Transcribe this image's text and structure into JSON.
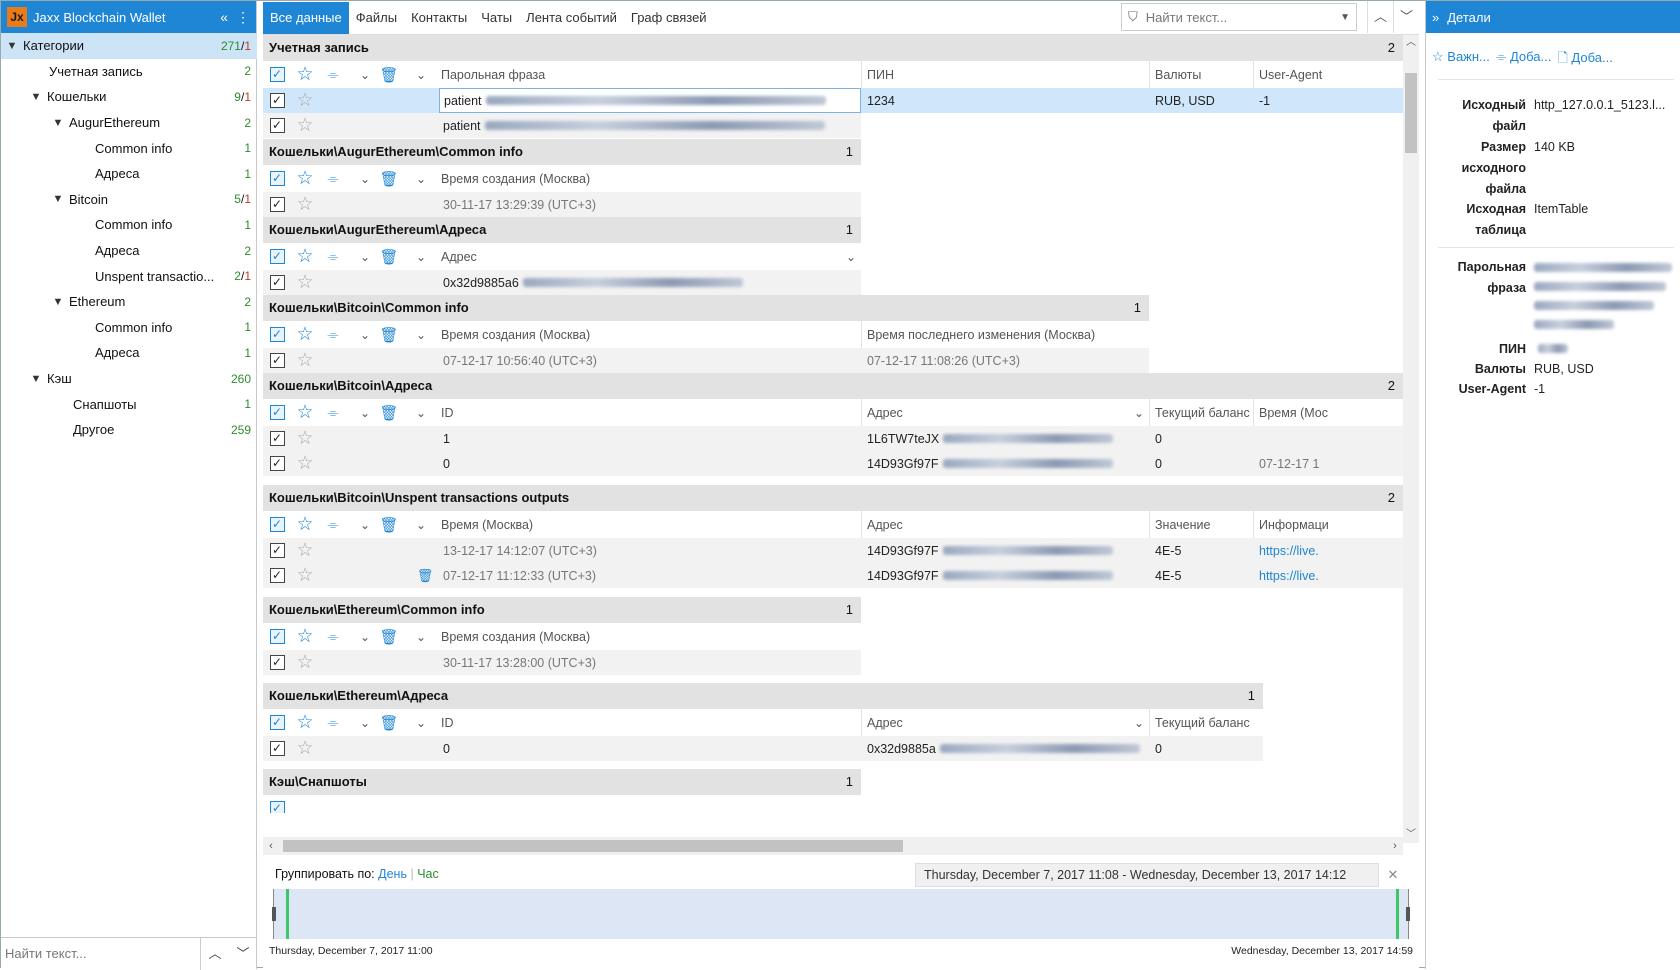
{
  "app": {
    "title": "Jaxx Blockchain Wallet",
    "logo": "Jx"
  },
  "tree": {
    "root": {
      "label": "Категории",
      "count": "271",
      "count_red": "1"
    },
    "items": [
      {
        "label": "Учетная запись",
        "count": "2"
      },
      {
        "label": "Кошельки",
        "count": "9",
        "count_red": "1"
      },
      {
        "label": "AugurEthereum",
        "count": "2"
      },
      {
        "label": "Common info",
        "count": "1"
      },
      {
        "label": "Адреса",
        "count": "1"
      },
      {
        "label": "Bitcoin",
        "count": "5",
        "count_red": "1"
      },
      {
        "label": "Common info",
        "count": "1"
      },
      {
        "label": "Адреса",
        "count": "2"
      },
      {
        "label": "Unspent transactio...",
        "count": "2",
        "count_red": "1"
      },
      {
        "label": "Ethereum",
        "count": "2"
      },
      {
        "label": "Common info",
        "count": "1"
      },
      {
        "label": "Адреса",
        "count": "1"
      },
      {
        "label": "Кэш",
        "count": "260"
      },
      {
        "label": "Снапшоты",
        "count": "1"
      },
      {
        "label": "Другое",
        "count": "259"
      }
    ],
    "search_placeholder": "Найти текст..."
  },
  "tabs": [
    "Все данные",
    "Файлы",
    "Контакты",
    "Чаты",
    "Лента событий",
    "Граф связей"
  ],
  "search": {
    "placeholder": "Найти текст..."
  },
  "groups": {
    "account": {
      "title": "Учетная запись",
      "count": "2",
      "cols": [
        "Парольная фраза",
        "ПИН",
        "Валюты",
        "User-Agent"
      ],
      "rows": [
        {
          "phrase": "patient",
          "pin": "1234",
          "cur": "RUB, USD",
          "ua": "-1"
        },
        {
          "phrase": "patient"
        }
      ]
    },
    "aug_common": {
      "title": "Кошельки\\AugurEthereum\\Common info",
      "count": "1",
      "col": "Время создания (Москва)",
      "value": "30-11-17 13:29:39 (UTC+3)"
    },
    "aug_addr": {
      "title": "Кошельки\\AugurEthereum\\Адреса",
      "count": "1",
      "col": "Адрес",
      "value": "0x32d9885a6"
    },
    "btc_common": {
      "title": "Кошельки\\Bitcoin\\Common info",
      "count": "1",
      "cols": [
        "Время создания (Москва)",
        "Время последнего изменения (Москва)"
      ],
      "values": [
        "07-12-17 10:56:40 (UTC+3)",
        "07-12-17 11:08:26 (UTC+3)"
      ]
    },
    "btc_addr": {
      "title": "Кошельки\\Bitcoin\\Адреса",
      "count": "2",
      "cols": [
        "ID",
        "Адрес",
        "Текущий баланс",
        "Время (Мос"
      ],
      "rows": [
        {
          "id": "1",
          "addr": "1L6TW7teJX",
          "bal": "0",
          "t": ""
        },
        {
          "id": "0",
          "addr": "14D93Gf97F",
          "bal": "0",
          "t": "07-12-17 1"
        }
      ]
    },
    "btc_unspent": {
      "title": "Кошельки\\Bitcoin\\Unspent transactions outputs",
      "count": "2",
      "cols": [
        "Время (Москва)",
        "Адрес",
        "Значение",
        "Информаци"
      ],
      "rows": [
        {
          "t": "13-12-17 14:12:07 (UTC+3)",
          "addr": "14D93Gf97F",
          "val": "4E-5",
          "info": "https://live."
        },
        {
          "t": "07-12-17 11:12:33 (UTC+3)",
          "addr": "14D93Gf97F",
          "val": "4E-5",
          "info": "https://live."
        }
      ]
    },
    "eth_common": {
      "title": "Кошельки\\Ethereum\\Common info",
      "count": "1",
      "col": "Время создания (Москва)",
      "value": "30-11-17 13:28:00 (UTC+3)"
    },
    "eth_addr": {
      "title": "Кошельки\\Ethereum\\Адреса",
      "count": "1",
      "cols": [
        "ID",
        "Адрес",
        "Текущий баланс"
      ],
      "row": {
        "id": "0",
        "addr": "0x32d9885a",
        "bal": "0"
      }
    },
    "cache_snap": {
      "title": "Кэш\\Снапшоты",
      "count": "1"
    }
  },
  "timeline": {
    "group_by_label": "Группировать по:",
    "day": "День",
    "hour": "Час",
    "range": "Thursday, December 7, 2017 11:08 - Wednesday, December 13, 2017 14:12",
    "start": "Thursday, December 7, 2017 11:00",
    "end": "Wednesday, December 13, 2017 14:59"
  },
  "details": {
    "title": "Детали",
    "actions": [
      "Важн...",
      "Доба...",
      "Доба..."
    ],
    "props": [
      {
        "k": "Исходный файл",
        "v": "http_127.0.0.1_5123.l..."
      },
      {
        "k": "Размер исходного файла",
        "v": "140 KB"
      },
      {
        "k": "Исходная таблица",
        "v": "ItemTable"
      },
      {
        "k": "Парольная фраза",
        "v": ""
      },
      {
        "k": "ПИН",
        "v": ""
      },
      {
        "k": "Валюты",
        "v": "RUB, USD"
      },
      {
        "k": "User-Agent",
        "v": "-1"
      }
    ]
  },
  "colors": {
    "accent": "#1e86d4",
    "group_bg": "#e2e2e2",
    "row_bg": "#f2f2f2",
    "selected": "#cfe6fb",
    "green": "#2e8b2e",
    "red": "#c0392b"
  }
}
